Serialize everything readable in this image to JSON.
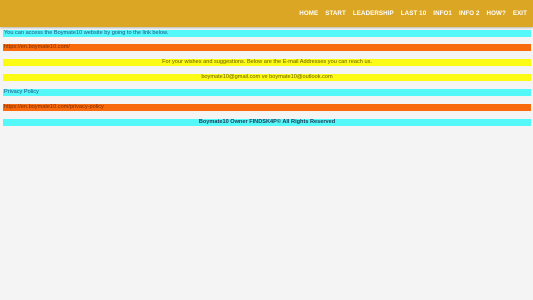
{
  "nav": {
    "items": [
      "HOME",
      "START",
      "LEADERSHIP",
      "LAST 10",
      "INFO1",
      "INFO 2",
      "HOW?",
      "EXIT"
    ]
  },
  "content": {
    "access_text": "You can access the Boymate10 website by going to the link below.",
    "site_link": "https://en.boymate10.com/",
    "wishes_text": "For your wishes and suggestions. Below are the E-mail Addresses you can reach us.",
    "emails_text": "boymate10@gmail.com ve boymate10@outlook.com",
    "privacy_label": "Privacy Policy",
    "privacy_link": "https://en.boymate10.com/privacy-policy",
    "footer_text": "Boymate10 Owner FINDSK4P© All Rights Reserved"
  },
  "colors": {
    "header": "#dba623",
    "cyan": "#55f8f8",
    "orange": "#f86a0c",
    "yellow": "#fbfb16",
    "background": "#f4f4f4"
  }
}
